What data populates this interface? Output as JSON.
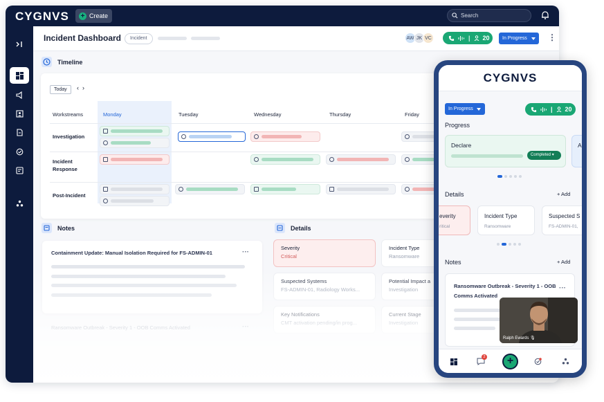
{
  "brand": {
    "logo": "CYGNVS"
  },
  "topbar": {
    "create_label": "Create",
    "search_placeholder": "Search"
  },
  "sidebar": {
    "expand_icon": "sidebar-expand-icon"
  },
  "header": {
    "title": "Incident Dashboard",
    "tag": "Incident",
    "avatars": [
      "AW",
      "JK",
      "VC"
    ],
    "participants": "20",
    "status": "In Progress",
    "menu": "⋮"
  },
  "timeline": {
    "title": "Timeline",
    "today": "Today",
    "prev": "‹",
    "next": "›",
    "workstreams_label": "Workstreams",
    "days": [
      "Monday",
      "Tuesday",
      "Wednesday",
      "Thursday",
      "Friday"
    ],
    "rows": [
      "Investigation",
      "Incident\nResponse",
      "Post-Incident"
    ]
  },
  "notes": {
    "title": "Notes",
    "items": [
      {
        "title": "Containment Update: Manual Isolation Required for FS-ADMIN-01",
        "menu": "···"
      },
      {
        "title": "Ransomware Outbreak - Severity 1 - OOB Comms Activated",
        "menu": "···"
      }
    ]
  },
  "details": {
    "title": "Details",
    "items": [
      {
        "label": "Severity",
        "value": "Critical"
      },
      {
        "label": "Incident Type",
        "value": "Ransomware"
      },
      {
        "label": "Suspected Systems",
        "value": "FS-ADMIN-01, Radiology Works..."
      },
      {
        "label": "Potential Impact a",
        "value": "Investigation"
      },
      {
        "label": "Key Notifications",
        "value": "CMT activation pending/in prog..."
      },
      {
        "label": "Current Stage",
        "value": "Investigation"
      }
    ]
  },
  "mobile": {
    "logo": "CYGNVS",
    "status": "In Progress",
    "participants": "20",
    "progress_title": "Progress",
    "progress_step": "Declare",
    "progress_step_next": "A",
    "progress_badge": "Completed",
    "details_title": "Details",
    "add_label": "+ Add",
    "details": [
      {
        "label": "everity",
        "value": "ritical"
      },
      {
        "label": "Incident Type",
        "value": "Ransomware"
      },
      {
        "label": "Suspected S",
        "value": "FS-ADMIN-01,"
      }
    ],
    "notes_title": "Notes",
    "note_title": "Ransomware Outbreak - Severity 1 - OOB Comms Activated",
    "note_menu": "···",
    "video_name": "Ralph Ewards",
    "chat_badge": "2",
    "fab": "+"
  },
  "colors": {
    "navy": "#0d1b3d",
    "accent_green": "#1aa774",
    "accent_blue": "#2467d8",
    "critical_red": "#d25b5b"
  }
}
